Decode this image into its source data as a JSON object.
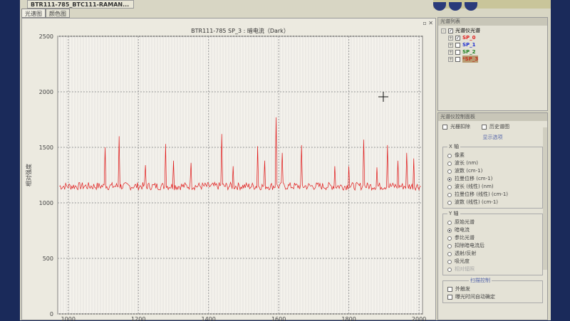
{
  "window": {
    "title": "BTR111-785_BTC111-RAMAN..."
  },
  "tabs": [
    {
      "label": "光谱图"
    },
    {
      "label": "颜色图"
    }
  ],
  "spectrum_list": {
    "title": "光谱列表",
    "root": "光谱仪光谱",
    "items": [
      {
        "label": "SP_0",
        "color": "#e02020",
        "checked": true
      },
      {
        "label": "SP_1",
        "color": "#2030d0",
        "checked": false
      },
      {
        "label": "SP_2",
        "color": "#208020",
        "checked": false
      },
      {
        "label": "*SP_3",
        "color": "#c03020",
        "checked": false
      }
    ]
  },
  "control": {
    "title": "光谱仪控制面板",
    "check1": "光栅扣除",
    "check2": "历史谱图",
    "display_options": "显示选项",
    "x_axis": {
      "label": "X 轴",
      "options": [
        "像素",
        "波长 (nm)",
        "波数 (cm-1)",
        "拉曼位移 (cm-1)",
        "波长 (线性) (nm)",
        "拉曼位移 (线性) (cm-1)",
        "波数 (线性) (cm-1)"
      ],
      "selected": 3
    },
    "y_axis": {
      "label": "Y 轴",
      "options": [
        "原始光谱",
        "暗电流",
        "参比光谱",
        "扣除暗电流后",
        "透射/反射",
        "吸光度",
        "相对辐照"
      ],
      "selected": 1,
      "disabled": 6
    },
    "trigger": {
      "label": "扫描控制",
      "options": [
        "外触发",
        "曝光时间自动确定"
      ]
    }
  },
  "chart_data": {
    "type": "line",
    "title": "BTR111-785  SP_3 : 暗电流（Dark）",
    "xlabel": "",
    "ylabel": "相对强度",
    "xlim": [
      970,
      2010
    ],
    "ylim": [
      0,
      2500
    ],
    "xticks": [
      1000,
      1200,
      1400,
      1600,
      1800,
      2000
    ],
    "yticks": [
      0,
      500,
      1000,
      1500,
      2000,
      2500
    ],
    "grid": true,
    "series": [
      {
        "name": "SP_3",
        "color": "#e01818",
        "baseline": 1150,
        "noise": 35,
        "peaks": [
          [
            1105,
            1500
          ],
          [
            1145,
            1600
          ],
          [
            1220,
            1340
          ],
          [
            1277,
            1530
          ],
          [
            1300,
            1380
          ],
          [
            1350,
            1360
          ],
          [
            1437,
            1620
          ],
          [
            1470,
            1330
          ],
          [
            1540,
            1510
          ],
          [
            1560,
            1380
          ],
          [
            1592,
            1770
          ],
          [
            1610,
            1450
          ],
          [
            1665,
            1520
          ],
          [
            1760,
            1330
          ],
          [
            1800,
            1330
          ],
          [
            1843,
            1570
          ],
          [
            1880,
            1320
          ],
          [
            1909,
            1520
          ],
          [
            1940,
            1380
          ],
          [
            1964,
            1450
          ],
          [
            1985,
            1400
          ]
        ]
      }
    ]
  }
}
